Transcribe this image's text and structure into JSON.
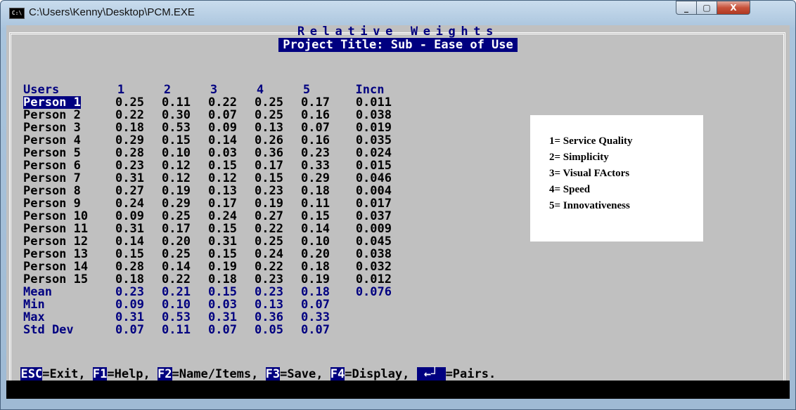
{
  "window": {
    "title": "C:\\Users\\Kenny\\Desktop\\PCM.EXE",
    "icon": "console-icon",
    "icon_text": "C:\\"
  },
  "controls": {
    "minimize": "minimize-icon",
    "maximize": "maximize-icon",
    "close": "close-icon",
    "minimize_glyph": "_",
    "maximize_glyph": "▢",
    "close_glyph": "X"
  },
  "header": {
    "title": "Relative Weights",
    "project": "Project Title: Sub - Ease of Use"
  },
  "table": {
    "headers": [
      "Users",
      "1",
      "2",
      "3",
      "4",
      "5",
      "Incn"
    ],
    "rows": [
      {
        "user": "Person 1",
        "values": [
          "0.25",
          "0.11",
          "0.22",
          "0.25",
          "0.17",
          "0.011"
        ]
      },
      {
        "user": "Person 2",
        "values": [
          "0.22",
          "0.30",
          "0.07",
          "0.25",
          "0.16",
          "0.038"
        ]
      },
      {
        "user": "Person 3",
        "values": [
          "0.18",
          "0.53",
          "0.09",
          "0.13",
          "0.07",
          "0.019"
        ]
      },
      {
        "user": "Person 4",
        "values": [
          "0.29",
          "0.15",
          "0.14",
          "0.26",
          "0.16",
          "0.035"
        ]
      },
      {
        "user": "Person 5",
        "values": [
          "0.28",
          "0.10",
          "0.03",
          "0.36",
          "0.23",
          "0.024"
        ]
      },
      {
        "user": "Person 6",
        "values": [
          "0.23",
          "0.12",
          "0.15",
          "0.17",
          "0.33",
          "0.015"
        ]
      },
      {
        "user": "Person 7",
        "values": [
          "0.31",
          "0.12",
          "0.12",
          "0.15",
          "0.29",
          "0.046"
        ]
      },
      {
        "user": "Person 8",
        "values": [
          "0.27",
          "0.19",
          "0.13",
          "0.23",
          "0.18",
          "0.004"
        ]
      },
      {
        "user": "Person 9",
        "values": [
          "0.24",
          "0.29",
          "0.17",
          "0.19",
          "0.11",
          "0.017"
        ]
      },
      {
        "user": "Person 10",
        "values": [
          "0.09",
          "0.25",
          "0.24",
          "0.27",
          "0.15",
          "0.037"
        ]
      },
      {
        "user": "Person 11",
        "values": [
          "0.31",
          "0.17",
          "0.15",
          "0.22",
          "0.14",
          "0.009"
        ]
      },
      {
        "user": "Person 12",
        "values": [
          "0.14",
          "0.20",
          "0.31",
          "0.25",
          "0.10",
          "0.045"
        ]
      },
      {
        "user": "Person 13",
        "values": [
          "0.15",
          "0.25",
          "0.15",
          "0.24",
          "0.20",
          "0.038"
        ]
      },
      {
        "user": "Person 14",
        "values": [
          "0.28",
          "0.14",
          "0.19",
          "0.22",
          "0.18",
          "0.032"
        ]
      },
      {
        "user": "Person 15",
        "values": [
          "0.18",
          "0.22",
          "0.18",
          "0.23",
          "0.19",
          "0.012"
        ]
      }
    ],
    "selected_row": 0,
    "stats": [
      {
        "label": "Mean",
        "values": [
          "0.23",
          "0.21",
          "0.15",
          "0.23",
          "0.18",
          "0.076"
        ]
      },
      {
        "label": "Min",
        "values": [
          "0.09",
          "0.10",
          "0.03",
          "0.13",
          "0.07",
          ""
        ]
      },
      {
        "label": "Max",
        "values": [
          "0.31",
          "0.53",
          "0.31",
          "0.36",
          "0.33",
          ""
        ]
      },
      {
        "label": "Std Dev",
        "values": [
          "0.07",
          "0.11",
          "0.07",
          "0.05",
          "0.07",
          ""
        ]
      }
    ]
  },
  "legend": [
    "1= Service Quality",
    "2= Simplicity",
    "3= Visual FActors",
    "4= Speed",
    "5= Innovativeness"
  ],
  "footer": [
    {
      "key": "ESC",
      "action": "=Exit,"
    },
    {
      "key": "F1",
      "action": "=Help,"
    },
    {
      "key": "F2",
      "action": "=Name/Items,"
    },
    {
      "key": "F3",
      "action": "=Save,"
    },
    {
      "key": "F4",
      "action": "=Display,"
    },
    {
      "key": " ←┘ ",
      "action": "=Pairs.",
      "icon": "enter-key-icon"
    }
  ]
}
